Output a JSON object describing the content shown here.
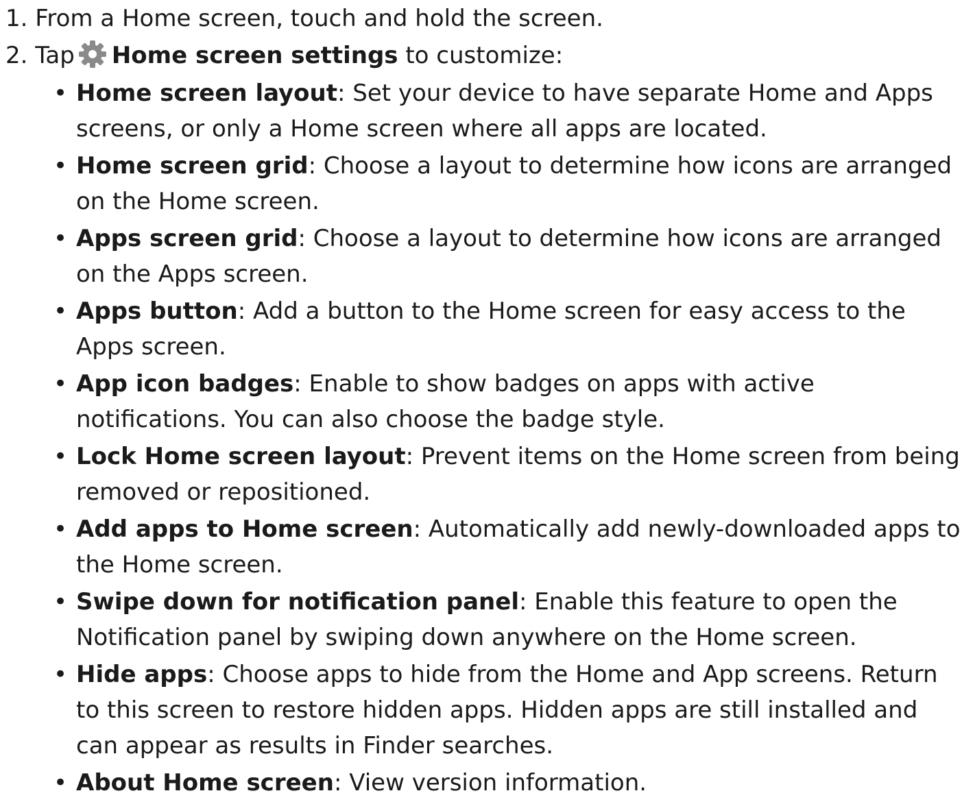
{
  "steps": [
    {
      "number": "1.",
      "text": "From a Home screen, touch and hold the screen."
    },
    {
      "number": "2.",
      "prefix": "Tap",
      "icon": "gear-icon",
      "bold": "Home screen settings",
      "suffix": "to customize:"
    }
  ],
  "options": [
    {
      "name": "Home screen layout",
      "description": ": Set your device to have separate Home and Apps screens, or only a Home screen where all apps are located."
    },
    {
      "name": "Home screen grid",
      "description": ": Choose a layout to determine how icons are arranged on the Home screen."
    },
    {
      "name": "Apps screen grid",
      "description": ": Choose a layout to determine how icons are arranged on the Apps screen."
    },
    {
      "name": "Apps button",
      "description": ": Add a button to the Home screen for easy access to the Apps screen."
    },
    {
      "name": "App icon badges",
      "description": ": Enable to show badges on apps with active notifications. You can also choose the badge style."
    },
    {
      "name": "Lock Home screen layout",
      "description": ": Prevent items on the Home screen from being removed or repositioned."
    },
    {
      "name": "Add apps to Home screen",
      "description": ": Automatically add newly-downloaded apps to the Home screen."
    },
    {
      "name": "Swipe down for notification panel",
      "description": ": Enable this feature to open the Notification panel by swiping down anywhere on the Home screen."
    },
    {
      "name": "Hide apps",
      "description": ": Choose apps to hide from the Home and App screens. Return to this screen to restore hidden apps. Hidden apps are still installed and can appear as results in Finder searches."
    },
    {
      "name": "About Home screen",
      "description": ": View version information."
    }
  ],
  "colors": {
    "text": "#1a1a1a",
    "icon": "#8a8a8a"
  }
}
